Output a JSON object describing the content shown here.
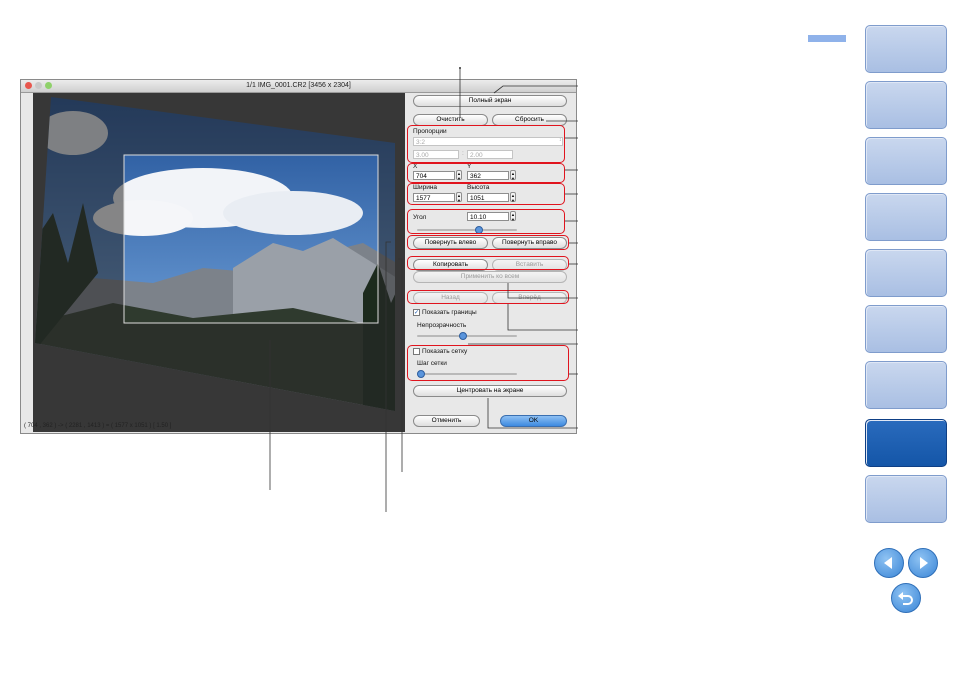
{
  "window": {
    "title": "1/1 IMG_0001.CR2 [3456 x 2304]",
    "status": "( 704 , 362 ) -> ( 2281 , 1413 ) = ( 1577 x 1051 ) [ 1.50 ]"
  },
  "panel": {
    "fullscreen": "Полный экран",
    "clear": "Очистить",
    "reset": "Сбросить",
    "aspect_label": "Пропорции",
    "aspect_value": "3:2",
    "aspect_w": "3.00",
    "aspect_colon": ":",
    "aspect_h": "2.00",
    "x_label": "X",
    "y_label": "Y",
    "x_value": "704",
    "y_value": "362",
    "width_label": "Ширина",
    "height_label": "Высота",
    "width_value": "1577",
    "height_value": "1051",
    "angle_label": "Угол",
    "angle_value": "10.10",
    "rotate_left": "Повернуть влево",
    "rotate_right": "Повернуть вправо",
    "copy": "Копировать",
    "paste": "Вставить",
    "apply_all": "Применить ко всем",
    "back": "Назад",
    "forward": "Вперёд",
    "show_borders": "Показать границы",
    "opacity_label": "Непрозрачность",
    "opacity_level": 0.45,
    "show_grid": "Показать сетку",
    "grid_step_label": "Шаг сетки",
    "grid_step_level": 0.0,
    "angle_level": 0.62,
    "center": "Центровать на экране",
    "cancel": "Отменить",
    "ok": "OK"
  },
  "colors": {
    "accent_red": "#e0141e",
    "nav_active": "#1456a8",
    "nav_inactive": "#b4c7e7"
  },
  "icons": {
    "prev": "arrow-left-icon",
    "next": "arrow-right-icon",
    "home": "return-home-icon"
  }
}
